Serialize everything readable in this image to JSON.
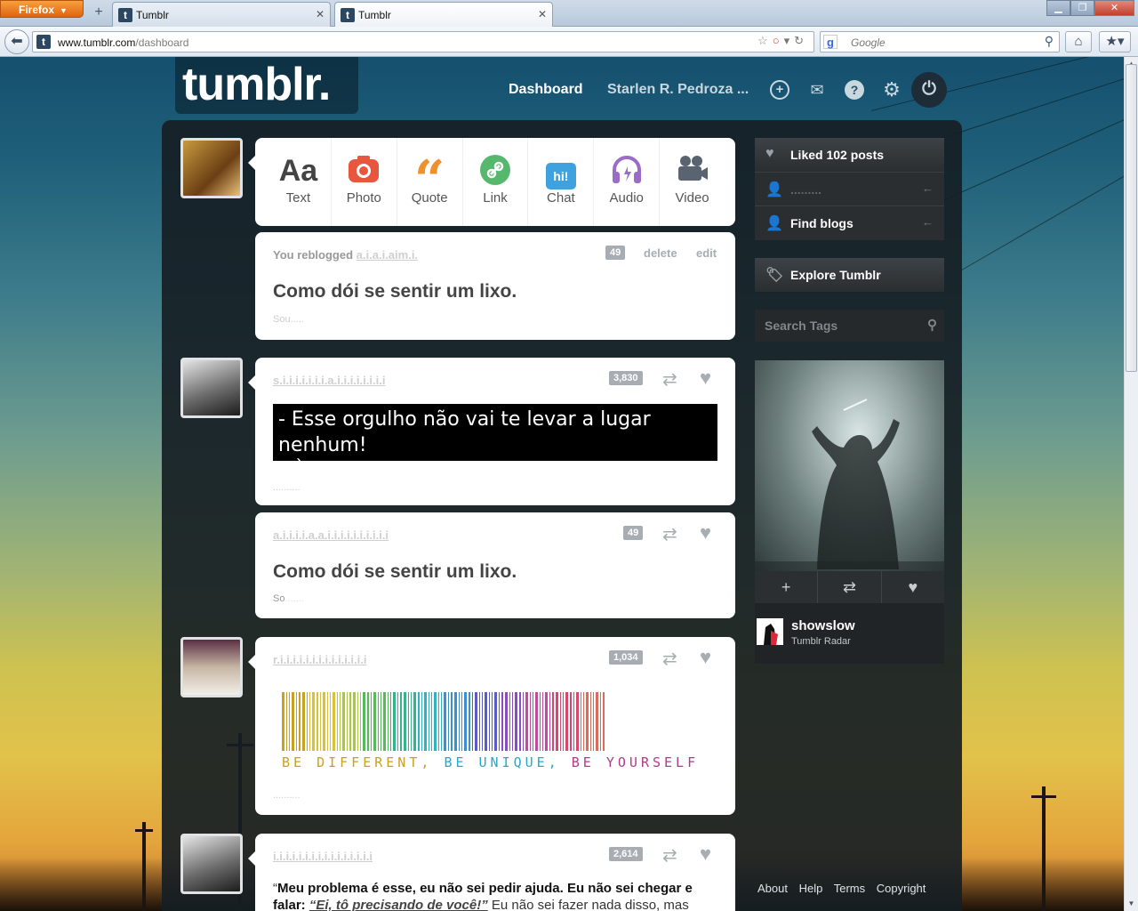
{
  "browser": {
    "menu_button": "Firefox",
    "tabs": [
      {
        "title": "Tumblr",
        "favicon": "t"
      },
      {
        "title": "Tumblr",
        "favicon": "t"
      }
    ],
    "url_domain": "www.tumblr.com",
    "url_path": "/dashboard",
    "search_placeholder": "Google"
  },
  "header": {
    "logo": "tumblr.",
    "nav_dashboard": "Dashboard",
    "nav_user": "Starlen R. Pedroza ..."
  },
  "post_types": [
    {
      "label": "Text",
      "icon": "Aa",
      "color": "#444444"
    },
    {
      "label": "Photo",
      "icon": "camera-icon",
      "color": "#e8563e"
    },
    {
      "label": "Quote",
      "icon": "“",
      "color": "#f0902b"
    },
    {
      "label": "Link",
      "icon": "link-icon",
      "color": "#56b86d"
    },
    {
      "label": "Chat",
      "icon": "hi!",
      "color": "#3fa2de"
    },
    {
      "label": "Audio",
      "icon": "headphones-icon",
      "color": "#9b6cc7"
    },
    {
      "label": "Video",
      "icon": "video-camera-icon",
      "color": "#5a6470"
    }
  ],
  "posts": [
    {
      "meta": "You reblogged",
      "notes": "49",
      "delete": "delete",
      "edit": "edit",
      "title": "Como dói se sentir um lixo."
    },
    {
      "notes": "3,830",
      "line1": "- Esse orgulho não vai te levar a lugar nenhum!",
      "line2": "- Òtimo, adoro ficar em casa."
    },
    {
      "notes": "49",
      "title": "Como dói se sentir um lixo.",
      "source_prefix": "So"
    },
    {
      "notes": "1,034",
      "barcode_text": [
        "BE DIFFERENT,",
        "BE UNIQUE,",
        "BE YOURSELF"
      ]
    },
    {
      "notes": "2,614",
      "q1": "“",
      "q_bold1": "Meu problema é esse",
      "q2": ", eu não sei pedir ajuda. Eu não sei chegar e falar: ",
      "q_em": "“Ei, tô precisando de você!”",
      "q3": " Eu não sei fazer nada disso, mas rezo"
    }
  ],
  "sidebar": {
    "liked": "Liked 102 posts",
    "find_blogs": "Find blogs",
    "explore": "Explore Tumblr",
    "search_tags": "Search Tags",
    "radar_user": "showslow",
    "radar_label": "Tumblr Radar"
  },
  "footer": [
    "About",
    "Help",
    "Terms",
    "Copyright"
  ]
}
